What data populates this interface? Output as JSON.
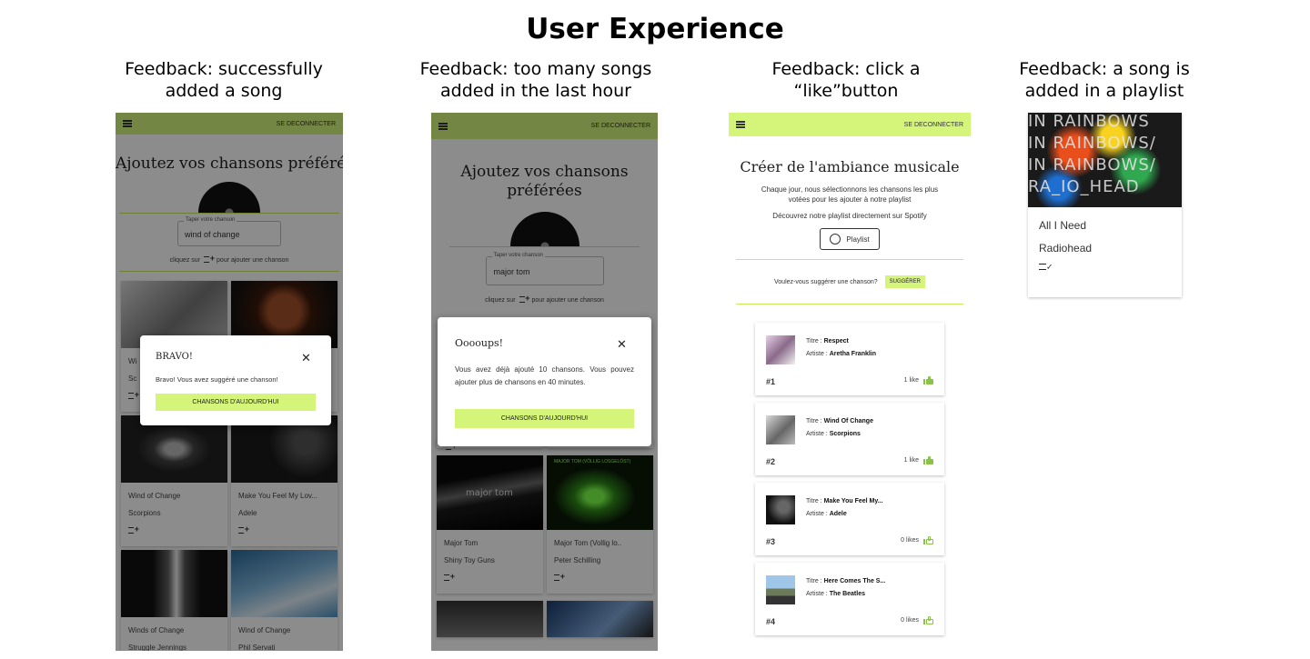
{
  "heading": "User Experience",
  "captions": {
    "p1": "Feedback: successfully added a song",
    "p2": "Feedback: too many songs added in the last hour",
    "p3": "Feedback: click a “like”button",
    "p4": "Feedback: a song is added in a playlist"
  },
  "colors": {
    "accent": "#d4f57a",
    "like": "#8bc34a"
  },
  "p1": {
    "logout": "SE DECONNECTER",
    "title": "Ajoutez vos chansons préférées",
    "input_label": "Taper votre chanson",
    "input_value": "wind of change",
    "hint_before": "cliquez sur",
    "hint_after": "pour ajouter une chanson",
    "cards": [
      {
        "title": "Wi",
        "artist": "Sc"
      },
      {
        "title": "",
        "artist": ""
      },
      {
        "title": "Wind of Change",
        "artist": "Scorpions"
      },
      {
        "title": "Make You Feel My Lov...",
        "artist": "Adele"
      },
      {
        "title": "Winds of Change",
        "artist": "Struggle Jennings"
      },
      {
        "title": "Wind of Change",
        "artist": "Phil Servati"
      }
    ],
    "modal": {
      "title": "BRAVO!",
      "message": "Bravo! Vous avez suggéré une chanson!",
      "button": "CHANSONS D'AUJOURD'HUI"
    }
  },
  "p2": {
    "logout": "SE DECONNECTER",
    "title": "Ajoutez vos chansons préférées",
    "input_label": "Taper votre chanson",
    "input_value": "major tom",
    "hint_before": "cliquez sur",
    "hint_after": "pour ajouter une chanson",
    "cards": [
      {
        "title": "Major Tom",
        "artist": "Shiny Toy Guns",
        "img_text": "major tom"
      },
      {
        "title": "Major Tom (Vollig lo..",
        "artist": "Peter Schilling",
        "img_text": "MAJOR TOM (VÖLLIG LOSGELÖST)"
      }
    ],
    "modal": {
      "title": "Ooooups!",
      "message": "Vous avez déjà ajouté 10 chansons. Vous pouvez ajouter plus de chansons en 40 minutes.",
      "button": "CHANSONS D'AUJOURD'HUI"
    }
  },
  "p3": {
    "logout": "SE DECONNECTER",
    "title": "Créer de l'ambiance musicale",
    "desc": "Chaque jour, nous sélectionnons les chansons les plus votées pour les ajouter à notre playlist",
    "spotify": "Découvrez notre playlist directement sur Spotify",
    "playlist_button": "Playlist",
    "suggest_text": "Voulez-vous suggérer une chanson?",
    "suggest_button": "SUGGÉRER",
    "title_label": "Titre :",
    "artist_label": "Artiste :",
    "ranks": [
      {
        "title": "Respect",
        "artist": "Aretha Franklin",
        "rank": "#1",
        "likes": "1 like",
        "liked": true
      },
      {
        "title": "Wind Of Change",
        "artist": "Scorpions",
        "rank": "#2",
        "likes": "1 like",
        "liked": true
      },
      {
        "title": "Make You Feel My...",
        "artist": "Adele",
        "rank": "#3",
        "likes": "0 likes",
        "liked": false
      },
      {
        "title": "Here Comes The S...",
        "artist": "The Beatles",
        "rank": "#4",
        "likes": "0 likes",
        "liked": false
      }
    ]
  },
  "p4": {
    "cover_lines": [
      "IN RAINBOWS",
      "IN RAINBOWS/",
      "IN RAINBOWS/",
      "RA_IO_HEAD"
    ],
    "title": "All I Need",
    "artist": "Radiohead"
  }
}
